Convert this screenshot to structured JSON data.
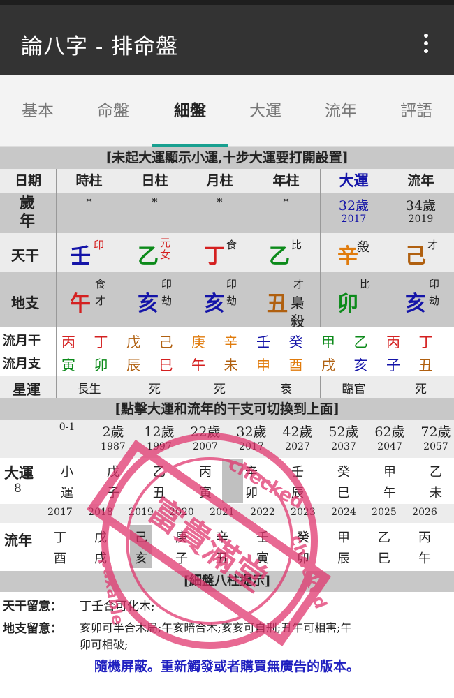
{
  "app": {
    "title": "論八字 - 排命盤"
  },
  "tabs": [
    "基本",
    "命盤",
    "細盤",
    "大運",
    "流年",
    "評語"
  ],
  "active_tab": "細盤",
  "notice_top": "[未起大運顯示小運,十步大運要打開設置]",
  "headers": [
    "日期",
    "時柱",
    "日柱",
    "月柱",
    "年柱",
    "大運",
    "流年"
  ],
  "age_row": {
    "label": "歲年",
    "pillars": [
      "*",
      "*",
      "*",
      "*"
    ],
    "dayun_age": "32歲",
    "dayun_year": "2017",
    "liunian_age": "34歲",
    "liunian_year": "2019"
  },
  "tiangan": {
    "label": "天干",
    "cells": [
      {
        "char": "壬",
        "god": "印"
      },
      {
        "char": "乙",
        "god": "元女"
      },
      {
        "char": "丁",
        "god": "食"
      },
      {
        "char": "乙",
        "god": "比"
      },
      {
        "char": "辛",
        "god": "殺"
      },
      {
        "char": "己",
        "god": "才"
      }
    ]
  },
  "dizhi": {
    "label": "地支",
    "cells": [
      {
        "char": "午",
        "gods": [
          "食",
          "才"
        ]
      },
      {
        "char": "亥",
        "gods": [
          "印",
          "劫"
        ]
      },
      {
        "char": "亥",
        "gods": [
          "印",
          "劫"
        ]
      },
      {
        "char": "丑",
        "gods": [
          "才",
          "梟",
          "殺"
        ]
      },
      {
        "char": "卯",
        "gods": [
          "比"
        ]
      },
      {
        "char": "亥",
        "gods": [
          "印",
          "劫"
        ]
      }
    ]
  },
  "liuyue_gan": {
    "label": "流月干",
    "chars": [
      "丙",
      "丁",
      "戊",
      "己",
      "庚",
      "辛",
      "壬",
      "癸",
      "甲",
      "乙",
      "丙",
      "丁"
    ]
  },
  "liuyue_zhi": {
    "label": "流月支",
    "chars": [
      "寅",
      "卯",
      "辰",
      "巳",
      "午",
      "未",
      "申",
      "酉",
      "戌",
      "亥",
      "子",
      "丑"
    ]
  },
  "xingyun": {
    "label": "星運",
    "values": [
      "長生",
      "死",
      "死",
      "衰",
      "臨官",
      "死"
    ]
  },
  "notice_mid": "[點擊大運和流年的干支可切換到上面]",
  "dayun": {
    "label": "大運",
    "number": "8",
    "ages": [
      "0-1",
      "2歲",
      "12歲",
      "22歲",
      "32歲",
      "42歲",
      "52歲",
      "62歲",
      "72歲"
    ],
    "years": [
      "",
      "1987",
      "1997",
      "2007",
      "2017",
      "2027",
      "2037",
      "2047",
      "2057"
    ],
    "gans": [
      "小",
      "戊",
      "乙",
      "丙",
      "辛",
      "壬",
      "癸",
      "甲",
      "乙"
    ],
    "zhis": [
      "運",
      "子",
      "丑",
      "寅",
      "卯",
      "辰",
      "巳",
      "午",
      "未"
    ]
  },
  "liunian": {
    "label": "流年",
    "years": [
      "2017",
      "2018",
      "2019",
      "2020",
      "2021",
      "2022",
      "2023",
      "2024",
      "2025",
      "2026"
    ],
    "gans": [
      "丁",
      "戊",
      "己",
      "庚",
      "辛",
      "壬",
      "癸",
      "甲",
      "乙",
      "丙"
    ],
    "zhis": [
      "酉",
      "戌",
      "亥",
      "子",
      "丑",
      "寅",
      "卯",
      "辰",
      "巳",
      "午"
    ]
  },
  "notice_bottom": "[細盤八柱提示]",
  "notes": {
    "tiangan_label": "天干留意：",
    "tiangan_text": "丁壬合可化木;",
    "dizhi_label": "地支留意：",
    "dizhi_text_1": "亥卯可半合木局;午亥暗合木;亥亥可自刑;丑午可相害;午",
    "dizhi_text_2": "卯可相破;"
  },
  "ad_text": "隨機屏蔽。重新觸發或者購買無廣告的版本。",
  "stamp": {
    "text_1": "checked",
    "text_2": "paxable",
    "text_3": "富貴滿堂",
    "text_4": "checked"
  },
  "colors": {
    "accent": "#18a090",
    "appbar": "#333333",
    "seal": "#e0306a"
  }
}
